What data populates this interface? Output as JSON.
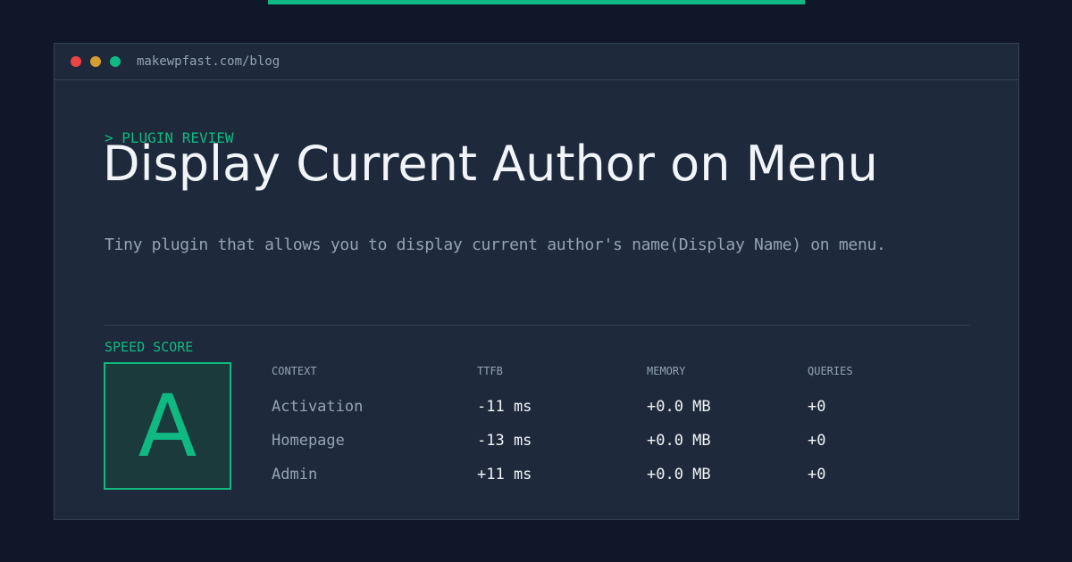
{
  "colors": {
    "background": "#0f1729",
    "panel": "#1e293b",
    "accent": "#10b981",
    "dot_red": "#ef4444",
    "dot_yellow": "#d69e2e",
    "dot_green": "#10b981"
  },
  "window": {
    "url": "makewpfast.com/blog"
  },
  "article": {
    "kicker": "> PLUGIN REVIEW",
    "title": "Display Current Author on Menu",
    "description": "Tiny plugin that allows you to display current author's name(Display Name) on menu."
  },
  "speed": {
    "label": "SPEED SCORE",
    "grade": "A"
  },
  "table": {
    "headers": [
      "CONTEXT",
      "TTFB",
      "MEMORY",
      "QUERIES"
    ],
    "rows": [
      [
        "Activation",
        "-11 ms",
        "+0.0 MB",
        "+0"
      ],
      [
        "Homepage",
        "-13 ms",
        "+0.0 MB",
        "+0"
      ],
      [
        "Admin",
        "+11 ms",
        "+0.0 MB",
        "+0"
      ]
    ]
  }
}
